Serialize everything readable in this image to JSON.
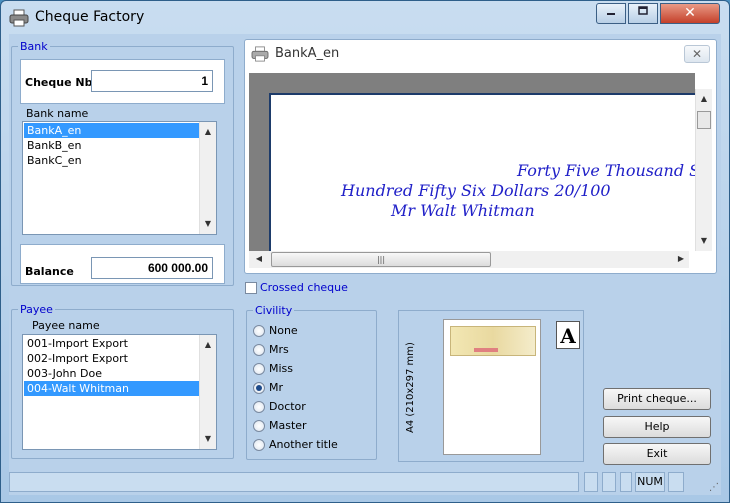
{
  "window": {
    "title": "Cheque Factory",
    "minimize_icon": "minimize-icon",
    "maximize_icon": "maximize-icon",
    "close_glyph": "✕"
  },
  "bank": {
    "legend": "Bank",
    "cheque_nb_label": "Cheque Nb",
    "cheque_nb_value": "1",
    "bank_name_label": "Bank name",
    "banks": [
      {
        "label": "BankA_en",
        "selected": true
      },
      {
        "label": "BankB_en",
        "selected": false
      },
      {
        "label": "BankC_en",
        "selected": false
      }
    ],
    "balance_label": "Balance",
    "balance_value": "600 000.00"
  },
  "preview": {
    "title": "BankA_en",
    "close_glyph": "✕",
    "line1": "Forty Five Thousand Sev",
    "line2": "Hundred Fifty Six Dollars  20/100",
    "line3": "Mr Walt Whitman",
    "crossed_label": "Crossed cheque",
    "crossed_checked": false
  },
  "payee": {
    "legend": "Payee",
    "name_label": "Payee name",
    "payees": [
      {
        "label": "001-Import Export",
        "selected": false
      },
      {
        "label": "002-Import Export",
        "selected": false
      },
      {
        "label": "003-John Doe",
        "selected": false
      },
      {
        "label": "004-Walt Whitman",
        "selected": true
      }
    ]
  },
  "civility": {
    "legend": "Civility",
    "options": [
      {
        "label": "None",
        "checked": false
      },
      {
        "label": "Mrs",
        "checked": false
      },
      {
        "label": "Miss",
        "checked": false
      },
      {
        "label": "Mr",
        "checked": true
      },
      {
        "label": "Doctor",
        "checked": false
      },
      {
        "label": "Master",
        "checked": false
      },
      {
        "label": "Another title",
        "checked": false
      }
    ]
  },
  "format": {
    "label": "A4 (210x297 mm)",
    "a_glyph": "A"
  },
  "buttons": {
    "print": "Print cheque...",
    "help": "Help",
    "exit": "Exit"
  },
  "status": {
    "num": "NUM"
  }
}
